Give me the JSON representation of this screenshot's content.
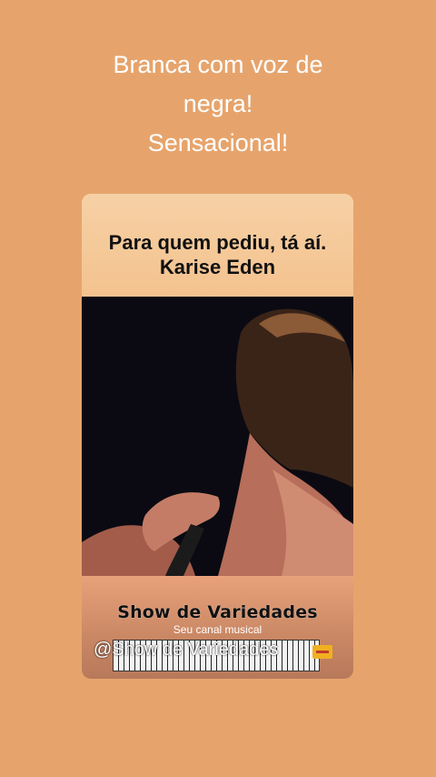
{
  "headline": [
    "Branca com voz de",
    "negra!",
    "Sensacional!"
  ],
  "card": {
    "title_line1": "Para quem pediu, tá aí.",
    "title_line2": "Karise Eden",
    "brand": "Show de Variedades",
    "subtitle": "Seu canal musical",
    "handle": "@Show de Variedades"
  },
  "icons": [
    "video-thumbnail",
    "ticket-icon"
  ]
}
